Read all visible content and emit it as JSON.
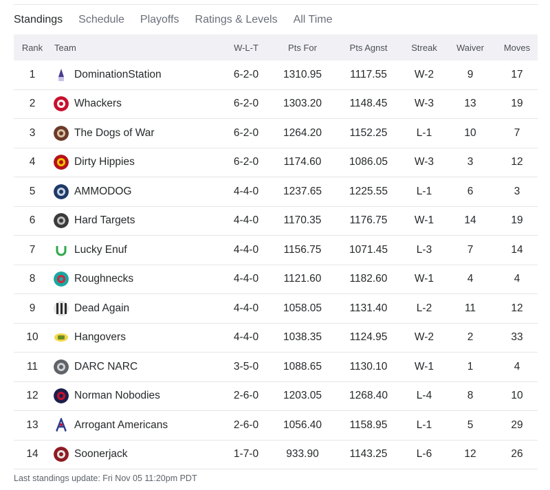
{
  "tabs": [
    {
      "label": "Standings",
      "active": true
    },
    {
      "label": "Schedule",
      "active": false
    },
    {
      "label": "Playoffs",
      "active": false
    },
    {
      "label": "Ratings & Levels",
      "active": false
    },
    {
      "label": "All Time",
      "active": false
    }
  ],
  "table": {
    "headers": {
      "rank": "Rank",
      "team": "Team",
      "wlt": "W-L-T",
      "pts_for": "Pts For",
      "pts_agnst": "Pts Agnst",
      "streak": "Streak",
      "waiver": "Waiver",
      "moves": "Moves"
    },
    "rows": [
      {
        "rank": "1",
        "team": "DominationStation",
        "icon": "rocket-logo-icon",
        "colors": [
          "#4a3d8f",
          "#c9c2e6"
        ],
        "wlt": "6-2-0",
        "pts_for": "1310.95",
        "pts_agnst": "1117.55",
        "streak": "W-2",
        "waiver": "9",
        "moves": "17"
      },
      {
        "rank": "2",
        "team": "Whackers",
        "icon": "panda-logo-icon",
        "colors": [
          "#c8102e",
          "#ffffff"
        ],
        "wlt": "6-2-0",
        "pts_for": "1303.20",
        "pts_agnst": "1148.45",
        "streak": "W-3",
        "waiver": "13",
        "moves": "19"
      },
      {
        "rank": "3",
        "team": "The Dogs of War",
        "icon": "war-dog-logo-icon",
        "colors": [
          "#6b3a2a",
          "#d9c3a5"
        ],
        "wlt": "6-2-0",
        "pts_for": "1264.20",
        "pts_agnst": "1152.25",
        "streak": "L-1",
        "waiver": "10",
        "moves": "7"
      },
      {
        "rank": "4",
        "team": "Dirty Hippies",
        "icon": "hippie-logo-icon",
        "colors": [
          "#b5121b",
          "#f2c500"
        ],
        "wlt": "6-2-0",
        "pts_for": "1174.60",
        "pts_agnst": "1086.05",
        "streak": "W-3",
        "waiver": "3",
        "moves": "12"
      },
      {
        "rank": "5",
        "team": "AMMODOG",
        "icon": "bulldog-logo-icon",
        "colors": [
          "#1f3a68",
          "#c9d3e2"
        ],
        "wlt": "4-4-0",
        "pts_for": "1237.65",
        "pts_agnst": "1225.55",
        "streak": "L-1",
        "waiver": "6",
        "moves": "3"
      },
      {
        "rank": "6",
        "team": "Hard Targets",
        "icon": "skull-logo-icon",
        "colors": [
          "#3a3a3a",
          "#bdbdbd"
        ],
        "wlt": "4-4-0",
        "pts_for": "1170.35",
        "pts_agnst": "1176.75",
        "streak": "W-1",
        "waiver": "14",
        "moves": "19"
      },
      {
        "rank": "7",
        "team": "Lucky Enuf",
        "icon": "horseshoe-logo-icon",
        "colors": [
          "#2ea84a",
          "#ffffff"
        ],
        "wlt": "4-4-0",
        "pts_for": "1156.75",
        "pts_agnst": "1071.45",
        "streak": "L-3",
        "waiver": "7",
        "moves": "14"
      },
      {
        "rank": "8",
        "team": "Roughnecks",
        "icon": "helmet-teal-logo-icon",
        "colors": [
          "#1aa7a1",
          "#d1263b"
        ],
        "wlt": "4-4-0",
        "pts_for": "1121.60",
        "pts_agnst": "1182.60",
        "streak": "W-1",
        "waiver": "4",
        "moves": "4"
      },
      {
        "rank": "9",
        "team": "Dead Again",
        "icon": "striped-logo-icon",
        "colors": [
          "#2b2b2b",
          "#e5e5e5"
        ],
        "wlt": "4-4-0",
        "pts_for": "1058.05",
        "pts_agnst": "1131.40",
        "streak": "L-2",
        "waiver": "11",
        "moves": "12"
      },
      {
        "rank": "10",
        "team": "Hangovers",
        "icon": "hangovers-logo-icon",
        "colors": [
          "#6a8c1f",
          "#f2d64b"
        ],
        "wlt": "4-4-0",
        "pts_for": "1038.35",
        "pts_agnst": "1124.95",
        "streak": "W-2",
        "waiver": "2",
        "moves": "33"
      },
      {
        "rank": "11",
        "team": "DARC NARC",
        "icon": "helmet-gray-logo-icon",
        "colors": [
          "#5f6368",
          "#cfd2d6"
        ],
        "wlt": "3-5-0",
        "pts_for": "1088.65",
        "pts_agnst": "1130.10",
        "streak": "W-1",
        "waiver": "1",
        "moves": "4"
      },
      {
        "rank": "12",
        "team": "Norman Nobodies",
        "icon": "n-ring-logo-icon",
        "colors": [
          "#1c1f4a",
          "#c8102e"
        ],
        "wlt": "2-6-0",
        "pts_for": "1203.05",
        "pts_agnst": "1268.40",
        "streak": "L-4",
        "waiver": "8",
        "moves": "10"
      },
      {
        "rank": "13",
        "team": "Arrogant Americans",
        "icon": "letter-a-logo-icon",
        "colors": [
          "#2b3f8c",
          "#c8102e"
        ],
        "wlt": "2-6-0",
        "pts_for": "1056.40",
        "pts_agnst": "1158.95",
        "streak": "L-1",
        "waiver": "5",
        "moves": "29"
      },
      {
        "rank": "14",
        "team": "Soonerjack",
        "icon": "helmet-red-logo-icon",
        "colors": [
          "#8f1b24",
          "#e6e6e6"
        ],
        "wlt": "1-7-0",
        "pts_for": "933.90",
        "pts_agnst": "1143.25",
        "streak": "L-6",
        "waiver": "12",
        "moves": "26"
      }
    ]
  },
  "footer": {
    "update_text": "Last standings update: Fri Nov 05 11:20pm PDT"
  }
}
